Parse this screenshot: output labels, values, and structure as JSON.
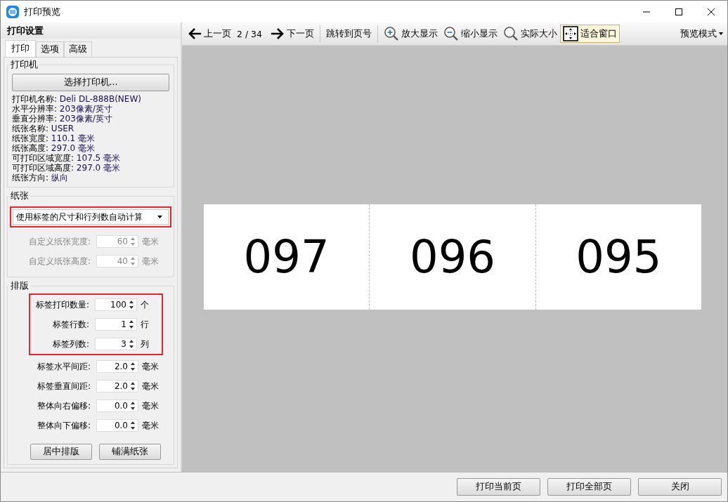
{
  "window": {
    "title": "打印预览"
  },
  "settings": {
    "title": "打印设置",
    "tabs": [
      {
        "label": "打印",
        "selected": true
      },
      {
        "label": "选项",
        "selected": false
      },
      {
        "label": "高级",
        "selected": false
      }
    ],
    "printer": {
      "title": "打印机",
      "button": "选择打印机...",
      "info": [
        {
          "label": "打印机名称:",
          "value": "Deli DL-888B(NEW)"
        },
        {
          "label": "水平分辨率:",
          "value": "203像素/英寸"
        },
        {
          "label": "垂直分辨率:",
          "value": "203像素/英寸"
        },
        {
          "label": "纸张名称:",
          "value": "USER"
        },
        {
          "label": "纸张宽度:",
          "value": "110.1 毫米"
        },
        {
          "label": "纸张高度:",
          "value": "297.0 毫米"
        },
        {
          "label": "可打印区域宽度:",
          "value": "107.5 毫米"
        },
        {
          "label": "可打印区域高度:",
          "value": "297.0 毫米"
        },
        {
          "label": "纸张方向:",
          "value": "纵向"
        }
      ]
    },
    "paper": {
      "title": "纸张",
      "dropdown": {
        "value": "使用标签的尺寸和行列数自动计算",
        "highlighted": true
      },
      "fields": [
        {
          "label": "自定义纸张宽度:",
          "value": "60",
          "unit": "毫米",
          "disabled": true,
          "highlighted": false
        },
        {
          "label": "自定义纸张高度:",
          "value": "40",
          "unit": "毫米",
          "disabled": true,
          "highlighted": false
        }
      ]
    },
    "layout": {
      "title": "排版",
      "fields": [
        {
          "label": "标签打印数量:",
          "value": "100",
          "unit": "个",
          "disabled": false,
          "highlighted": true
        },
        {
          "label": "标签行数:",
          "value": "1",
          "unit": "行",
          "disabled": false,
          "highlighted": true
        },
        {
          "label": "标签列数:",
          "value": "3",
          "unit": "列",
          "disabled": false,
          "highlighted": true
        },
        {
          "label": "标签水平间距:",
          "value": "2.0",
          "unit": "毫米",
          "disabled": false,
          "highlighted": false
        },
        {
          "label": "标签垂直间距:",
          "value": "2.0",
          "unit": "毫米",
          "disabled": false,
          "highlighted": false
        },
        {
          "label": "整体向右偏移:",
          "value": "0.0",
          "unit": "毫米",
          "disabled": false,
          "highlighted": false
        },
        {
          "label": "整体向下偏移:",
          "value": "0.0",
          "unit": "毫米",
          "disabled": false,
          "highlighted": false
        }
      ],
      "buttons": [
        "居中排版",
        "铺满纸张"
      ]
    }
  },
  "toolbar": {
    "items": [
      {
        "kind": "prev",
        "label": "上一页",
        "selected": false
      },
      {
        "kind": "text",
        "label": "2 / 34"
      },
      {
        "kind": "next",
        "label": "下一页",
        "selected": false
      },
      {
        "kind": "separator"
      },
      {
        "kind": "plain",
        "label": "跳转到页号",
        "selected": false
      },
      {
        "kind": "separator"
      },
      {
        "kind": "zoomin",
        "label": "放大显示",
        "selected": false
      },
      {
        "kind": "zoomout",
        "label": "缩小显示",
        "selected": false
      },
      {
        "kind": "actual",
        "label": "实际大小",
        "selected": false
      },
      {
        "kind": "fit",
        "label": "适合窗口",
        "selected": true
      }
    ],
    "mode_menu": "预览模式"
  },
  "preview": {
    "labels": [
      "097",
      "096",
      "095"
    ]
  },
  "footer": {
    "buttons": [
      "打印当前页",
      "打印全部页",
      "关闭"
    ]
  }
}
